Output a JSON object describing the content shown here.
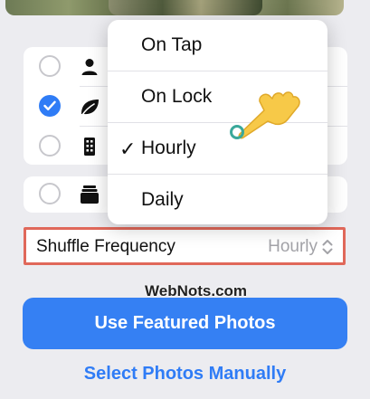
{
  "photos": [
    "photo-1",
    "photo-2",
    "photo-3"
  ],
  "options": [
    {
      "icon": "person-icon",
      "selected": false
    },
    {
      "icon": "leaf-icon",
      "selected": true
    },
    {
      "icon": "building-icon",
      "selected": false
    }
  ],
  "options_extra": {
    "icon": "photo-stack-icon",
    "selected": false
  },
  "dropdown": {
    "items": [
      {
        "label": "On Tap",
        "checked": false
      },
      {
        "label": "On Lock",
        "checked": false
      },
      {
        "label": "Hourly",
        "checked": true
      },
      {
        "label": "Daily",
        "checked": false
      }
    ],
    "check_glyph": "✓"
  },
  "shuffle": {
    "label": "Shuffle Frequency",
    "value": "Hourly"
  },
  "watermark": "WebNots.com",
  "buttons": {
    "primary": "Use Featured Photos",
    "secondary": "Select Photos Manually"
  },
  "colors": {
    "accent": "#3580f3",
    "highlight_border": "#e0685a",
    "cursor": "#f7c948"
  }
}
